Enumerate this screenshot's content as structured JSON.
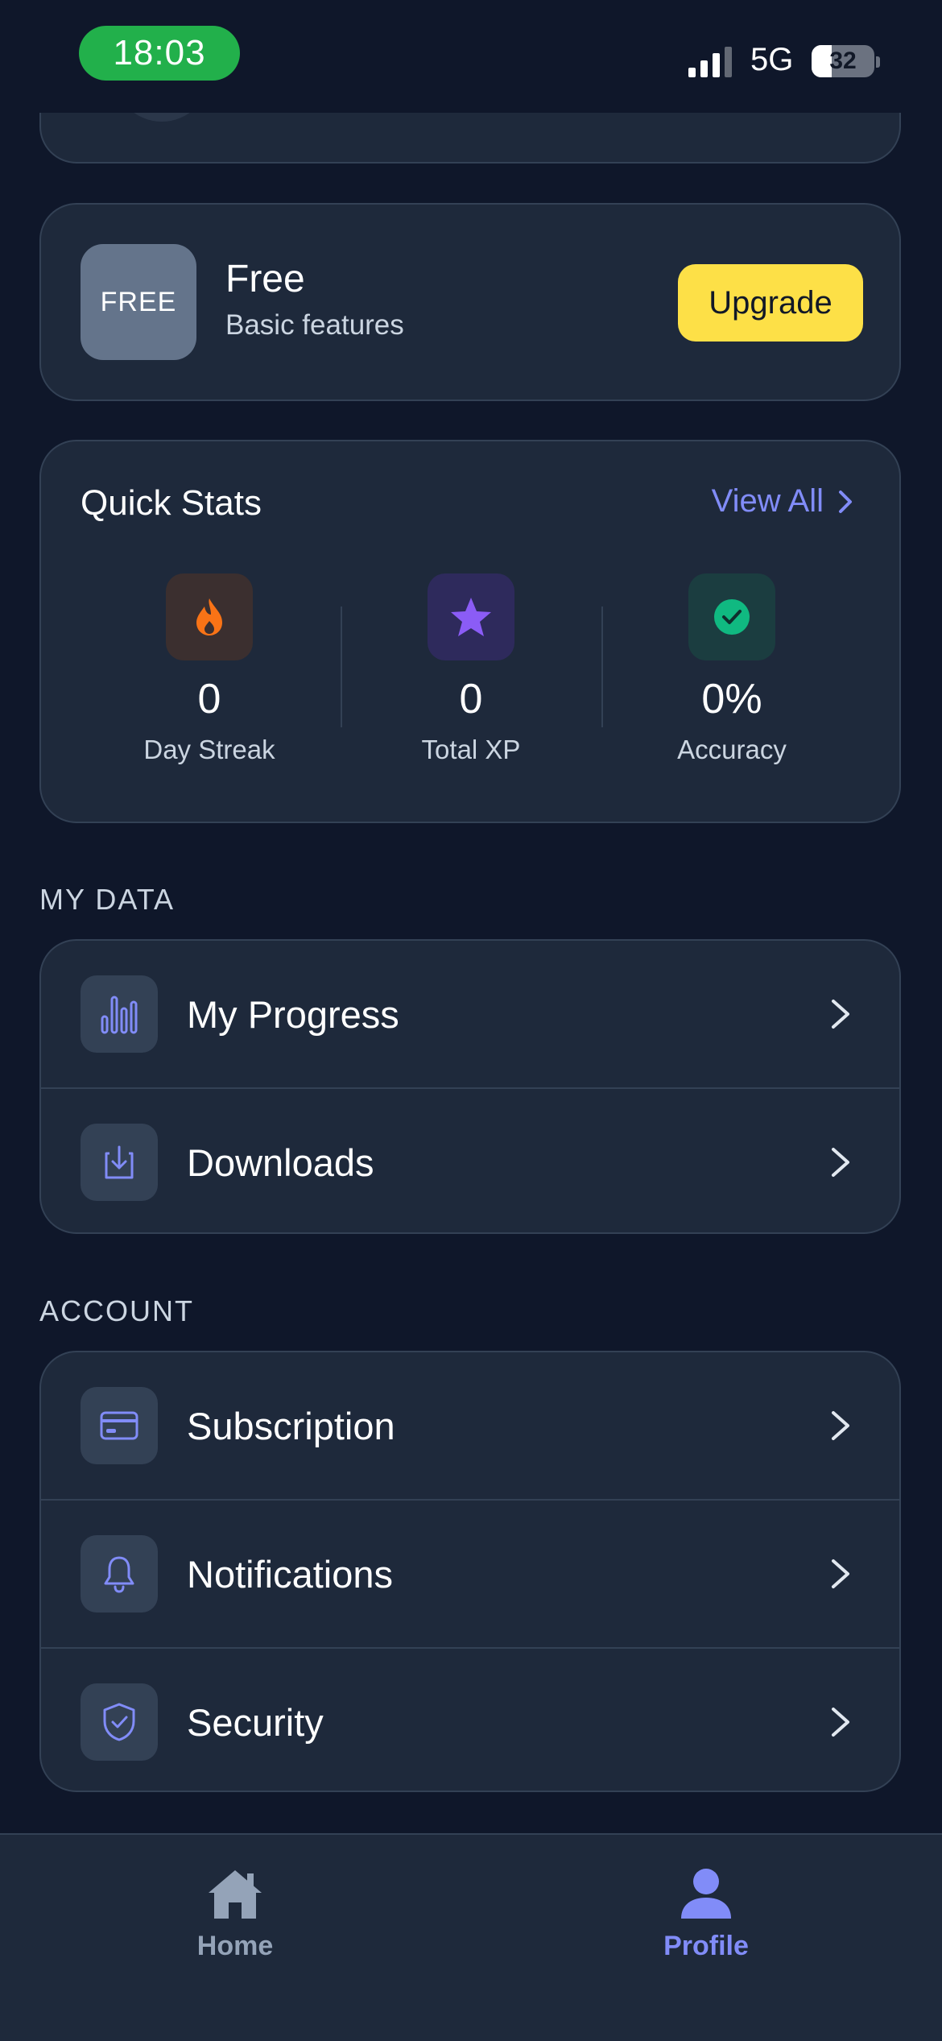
{
  "status_bar": {
    "time": "18:03",
    "network": "5G",
    "battery": "32",
    "battery_level": 0.32
  },
  "plan": {
    "badge": "FREE",
    "title": "Free",
    "subtitle": "Basic features",
    "upgrade_label": "Upgrade"
  },
  "quick_stats": {
    "title": "Quick Stats",
    "view_all": "View All",
    "items": [
      {
        "value": "0",
        "label": "Day Streak",
        "icon": "flame-icon",
        "color": "#f97316"
      },
      {
        "value": "0",
        "label": "Total XP",
        "icon": "star-icon",
        "color": "#8b5cf6"
      },
      {
        "value": "0%",
        "label": "Accuracy",
        "icon": "check-circle-icon",
        "color": "#10b981"
      }
    ]
  },
  "sections": {
    "my_data": {
      "label": "MY DATA",
      "items": [
        {
          "label": "My Progress",
          "icon": "bar-chart-icon"
        },
        {
          "label": "Downloads",
          "icon": "download-icon"
        }
      ]
    },
    "account": {
      "label": "ACCOUNT",
      "items": [
        {
          "label": "Subscription",
          "icon": "credit-card-icon"
        },
        {
          "label": "Notifications",
          "icon": "bell-icon"
        },
        {
          "label": "Security",
          "icon": "shield-check-icon"
        }
      ]
    }
  },
  "tabbar": {
    "home": "Home",
    "profile": "Profile",
    "active": "profile"
  },
  "colors": {
    "accent": "#818cf8",
    "upgrade": "#fde047",
    "background": "#0f172a",
    "card": "#1e293b"
  }
}
